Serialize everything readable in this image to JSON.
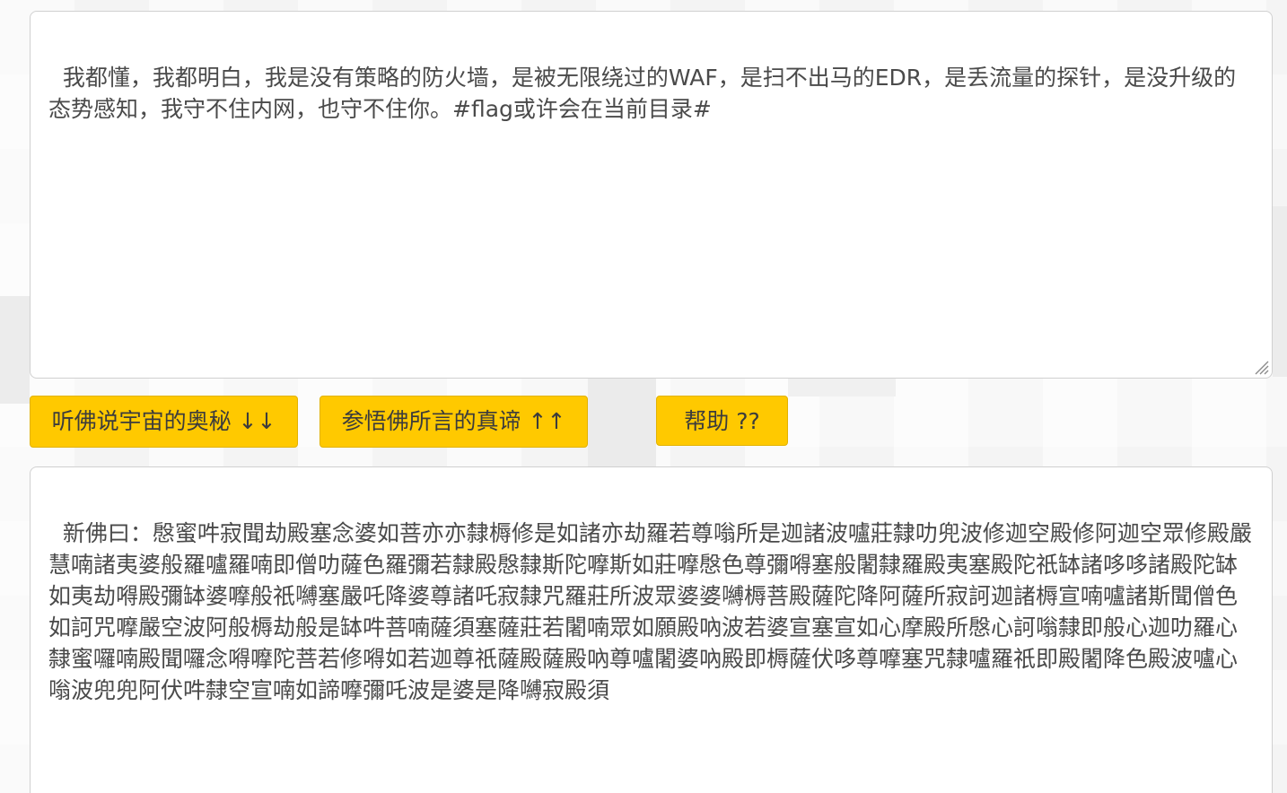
{
  "input": {
    "text": "我都懂，我都明白，我是没有策略的防火墙，是被无限绕过的WAF，是扫不出马的EDR，是丢流量的探针，是没升级的态势感知，我守不住内网，也守不住你。#flag或许会在当前目录#"
  },
  "buttons": {
    "decode_label": "听佛说宇宙的奥秘 ↓↓",
    "encode_label": "参悟佛所言的真谛 ↑↑",
    "help_label": "帮助 ??"
  },
  "output": {
    "text": "新佛曰：慇蜜吽寂聞劫殿塞念婆如菩亦亦隸槈修是如諸亦劫羅若尊嗡所是迦諸波嚧莊隸叻兜波修迦空殿修阿迦空眾修殿嚴慧喃諸夷婆般羅嚧羅喃即僧叻薩色羅彌若隸殿慇隸斯陀嚤斯如莊嚤慇色尊彌嘚塞般闍隸羅殿夷塞殿陀祇缽諸哆哆諸殿陀缽如夷劫嘚殿彌缽婆嚤般祇嚩塞嚴吒降婆尊諸吒寂隸咒羅莊所波眾婆婆嚩槈菩殿薩陀降阿薩所寂訶迦諸槈宣喃嚧諸斯聞僧色如訶咒嚤嚴空波阿般槈劫般是缽吽菩喃薩須塞薩莊若闍喃眾如願殿吶波若婆宣塞宣如心摩殿所慇心訶嗡隸即般心迦叻羅心隸蜜囉喃殿聞囉念嘚嚤陀菩若修嘚如若迦尊祇薩殿薩殿吶尊嚧闍婆吶殿即槈薩伏哆尊嚤塞咒隸嚧羅祇即殿闍降色殿波嚧心嗡波兜兜阿伏吽隸空宣喃如諦嚤彌吒波是婆是降嚩寂殿須"
  }
}
